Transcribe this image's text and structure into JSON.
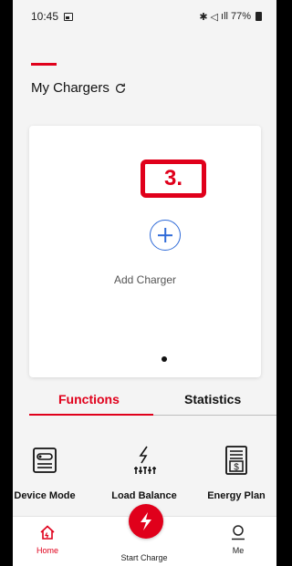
{
  "status_bar": {
    "time": "10:45",
    "status_icons": "✱ ◁ ᵑᵒ 4G .∥",
    "battery": "77%"
  },
  "header": {
    "title": "My Chargers"
  },
  "card": {
    "step_badge": "3.",
    "add_label": "Add Charger"
  },
  "tabs": [
    {
      "label": "Functions",
      "active": true
    },
    {
      "label": "Statistics",
      "active": false
    }
  ],
  "functions": [
    {
      "label": "Device Mode",
      "icon": "device-mode-icon"
    },
    {
      "label": "Load Balance",
      "icon": "load-balance-icon"
    },
    {
      "label": "Energy Plan",
      "icon": "energy-plan-icon"
    }
  ],
  "bottom_nav": {
    "home": "Home",
    "start": "Start Charge",
    "me": "Me"
  },
  "colors": {
    "accent": "#e0001b",
    "link_blue": "#2f6bd8",
    "background": "#f4f4f4"
  }
}
